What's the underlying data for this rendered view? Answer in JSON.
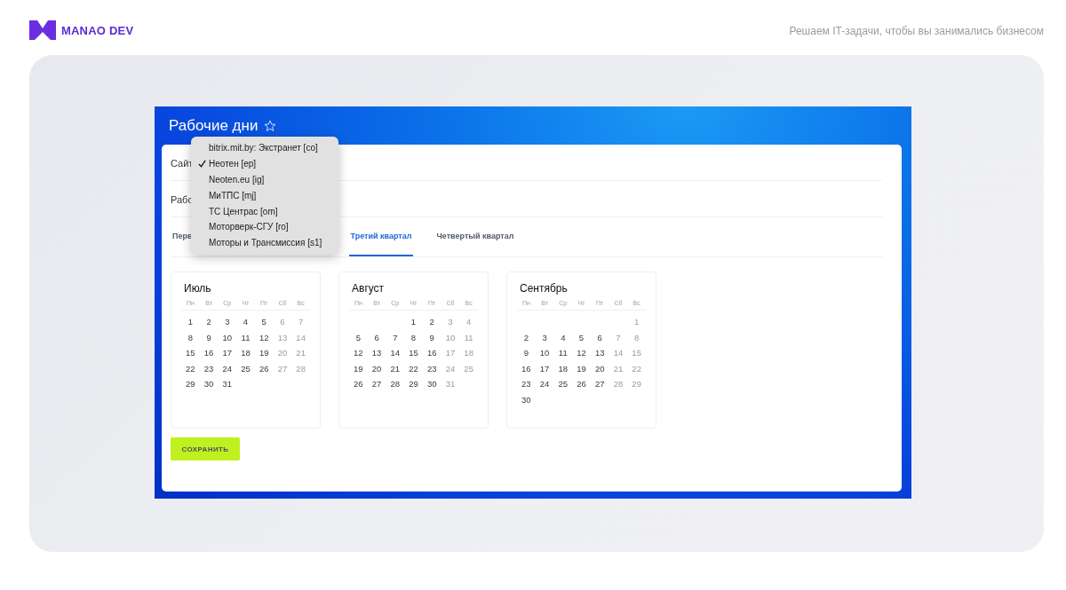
{
  "header": {
    "brand": "MANAO DEV",
    "tagline": "Решаем IT-задачи, чтобы вы занимались бизнесом"
  },
  "window": {
    "title": "Рабочие дни"
  },
  "form": {
    "rows": [
      {
        "label": "Сайт"
      },
      {
        "label": "Рабо"
      }
    ]
  },
  "tabs": [
    {
      "label": "Перв",
      "selected": false
    },
    {
      "label": "Третий квартал",
      "selected": true
    },
    {
      "label": "Четвертый квартал",
      "selected": false
    }
  ],
  "dropdown": {
    "items": [
      {
        "label": "bitrix.mit.by: Экстранет [co]",
        "selected": false
      },
      {
        "label": "Неотен [ep]",
        "selected": true
      },
      {
        "label": "Neoten.eu [ig]",
        "selected": false
      },
      {
        "label": "МиТПС [mj]",
        "selected": false
      },
      {
        "label": "ТС Центрас [om]",
        "selected": false
      },
      {
        "label": "Моторверк-СГУ [ro]",
        "selected": false
      },
      {
        "label": "Моторы и Трансмиссия [s1]",
        "selected": false
      }
    ]
  },
  "months": [
    {
      "name": "Июль",
      "weekdays": [
        "Пн",
        "Вт",
        "Ср",
        "Чт",
        "Пт",
        "Сб",
        "Вс"
      ],
      "cells": [
        {
          "kind": "day",
          "day": "1",
          "off": false
        },
        {
          "kind": "day",
          "day": "2",
          "off": false
        },
        {
          "kind": "day",
          "day": "3",
          "off": false
        },
        {
          "kind": "day",
          "day": "4",
          "off": false
        },
        {
          "kind": "day",
          "day": "5",
          "off": false
        },
        {
          "kind": "day",
          "day": "6",
          "off": true
        },
        {
          "kind": "day",
          "day": "7",
          "off": true
        },
        {
          "kind": "day",
          "day": "8",
          "off": false
        },
        {
          "kind": "day",
          "day": "9",
          "off": false
        },
        {
          "kind": "day",
          "day": "10",
          "off": false
        },
        {
          "kind": "day",
          "day": "11",
          "off": false
        },
        {
          "kind": "day",
          "day": "12",
          "off": false
        },
        {
          "kind": "day",
          "day": "13",
          "off": true
        },
        {
          "kind": "day",
          "day": "14",
          "off": true
        },
        {
          "kind": "day",
          "day": "15",
          "off": false
        },
        {
          "kind": "day",
          "day": "16",
          "off": false
        },
        {
          "kind": "day",
          "day": "17",
          "off": false
        },
        {
          "kind": "day",
          "day": "18",
          "off": false
        },
        {
          "kind": "day",
          "day": "19",
          "off": false
        },
        {
          "kind": "day",
          "day": "20",
          "off": true
        },
        {
          "kind": "day",
          "day": "21",
          "off": true
        },
        {
          "kind": "day",
          "day": "22",
          "off": false
        },
        {
          "kind": "day",
          "day": "23",
          "off": false
        },
        {
          "kind": "day",
          "day": "24",
          "off": false
        },
        {
          "kind": "day",
          "day": "25",
          "off": false
        },
        {
          "kind": "day",
          "day": "26",
          "off": false
        },
        {
          "kind": "day",
          "day": "27",
          "off": true
        },
        {
          "kind": "day",
          "day": "28",
          "off": true
        },
        {
          "kind": "day",
          "day": "29",
          "off": false
        },
        {
          "kind": "day",
          "day": "30",
          "off": false
        },
        {
          "kind": "day",
          "day": "31",
          "off": false
        }
      ]
    },
    {
      "name": "Август",
      "weekdays": [
        "Пн",
        "Вт",
        "Ср",
        "Чт",
        "Пт",
        "Сб",
        "Вс"
      ],
      "cells": [
        {
          "kind": "blank"
        },
        {
          "kind": "blank"
        },
        {
          "kind": "blank"
        },
        {
          "kind": "day",
          "day": "1",
          "off": false
        },
        {
          "kind": "day",
          "day": "2",
          "off": false
        },
        {
          "kind": "day",
          "day": "3",
          "off": true
        },
        {
          "kind": "day",
          "day": "4",
          "off": true
        },
        {
          "kind": "day",
          "day": "5",
          "off": false
        },
        {
          "kind": "day",
          "day": "6",
          "off": false
        },
        {
          "kind": "day",
          "day": "7",
          "off": false
        },
        {
          "kind": "day",
          "day": "8",
          "off": false
        },
        {
          "kind": "day",
          "day": "9",
          "off": false
        },
        {
          "kind": "day",
          "day": "10",
          "off": true
        },
        {
          "kind": "day",
          "day": "11",
          "off": true
        },
        {
          "kind": "day",
          "day": "12",
          "off": false
        },
        {
          "kind": "day",
          "day": "13",
          "off": false
        },
        {
          "kind": "day",
          "day": "14",
          "off": false
        },
        {
          "kind": "day",
          "day": "15",
          "off": false
        },
        {
          "kind": "day",
          "day": "16",
          "off": false
        },
        {
          "kind": "day",
          "day": "17",
          "off": true
        },
        {
          "kind": "day",
          "day": "18",
          "off": true
        },
        {
          "kind": "day",
          "day": "19",
          "off": false
        },
        {
          "kind": "day",
          "day": "20",
          "off": false
        },
        {
          "kind": "day",
          "day": "21",
          "off": false
        },
        {
          "kind": "day",
          "day": "22",
          "off": false
        },
        {
          "kind": "day",
          "day": "23",
          "off": false
        },
        {
          "kind": "day",
          "day": "24",
          "off": true
        },
        {
          "kind": "day",
          "day": "25",
          "off": true
        },
        {
          "kind": "day",
          "day": "26",
          "off": false
        },
        {
          "kind": "day",
          "day": "27",
          "off": false
        },
        {
          "kind": "day",
          "day": "28",
          "off": false
        },
        {
          "kind": "day",
          "day": "29",
          "off": false
        },
        {
          "kind": "day",
          "day": "30",
          "off": false
        },
        {
          "kind": "day",
          "day": "31",
          "off": true
        }
      ]
    },
    {
      "name": "Сентябрь",
      "weekdays": [
        "Пн",
        "Вт",
        "Ср",
        "Чт",
        "Пт",
        "Сб",
        "Вс"
      ],
      "cells": [
        {
          "kind": "blank"
        },
        {
          "kind": "blank"
        },
        {
          "kind": "blank"
        },
        {
          "kind": "blank"
        },
        {
          "kind": "blank"
        },
        {
          "kind": "blank"
        },
        {
          "kind": "day",
          "day": "1",
          "off": true
        },
        {
          "kind": "day",
          "day": "2",
          "off": false
        },
        {
          "kind": "day",
          "day": "3",
          "off": false
        },
        {
          "kind": "day",
          "day": "4",
          "off": false
        },
        {
          "kind": "day",
          "day": "5",
          "off": false
        },
        {
          "kind": "day",
          "day": "6",
          "off": false
        },
        {
          "kind": "day",
          "day": "7",
          "off": true
        },
        {
          "kind": "day",
          "day": "8",
          "off": true
        },
        {
          "kind": "day",
          "day": "9",
          "off": false
        },
        {
          "kind": "day",
          "day": "10",
          "off": false
        },
        {
          "kind": "day",
          "day": "11",
          "off": false
        },
        {
          "kind": "day",
          "day": "12",
          "off": false
        },
        {
          "kind": "day",
          "day": "13",
          "off": false
        },
        {
          "kind": "day",
          "day": "14",
          "off": true
        },
        {
          "kind": "day",
          "day": "15",
          "off": true
        },
        {
          "kind": "day",
          "day": "16",
          "off": false
        },
        {
          "kind": "day",
          "day": "17",
          "off": false
        },
        {
          "kind": "day",
          "day": "18",
          "off": false
        },
        {
          "kind": "day",
          "day": "19",
          "off": false
        },
        {
          "kind": "day",
          "day": "20",
          "off": false
        },
        {
          "kind": "day",
          "day": "21",
          "off": true
        },
        {
          "kind": "day",
          "day": "22",
          "off": true
        },
        {
          "kind": "day",
          "day": "23",
          "off": false
        },
        {
          "kind": "day",
          "day": "24",
          "off": false
        },
        {
          "kind": "day",
          "day": "25",
          "off": false
        },
        {
          "kind": "day",
          "day": "26",
          "off": false
        },
        {
          "kind": "day",
          "day": "27",
          "off": false
        },
        {
          "kind": "day",
          "day": "28",
          "off": true
        },
        {
          "kind": "day",
          "day": "29",
          "off": true
        },
        {
          "kind": "day",
          "day": "30",
          "off": false
        }
      ]
    }
  ],
  "save_button": {
    "label": "СОХРАНИТЬ"
  }
}
